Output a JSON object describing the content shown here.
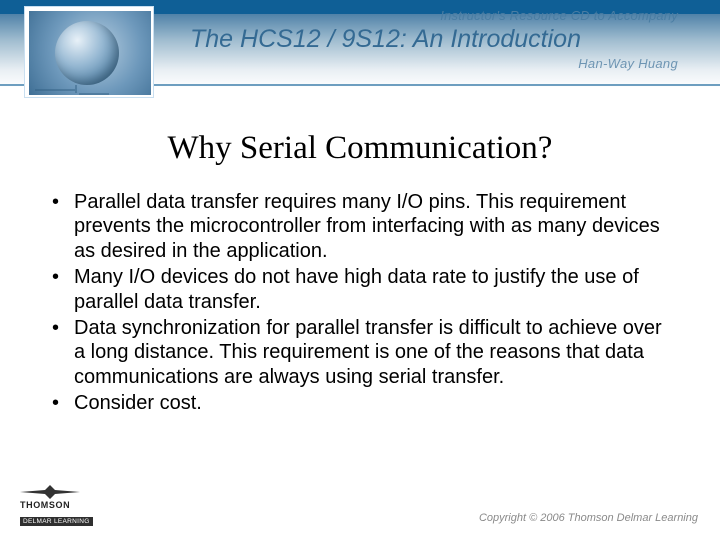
{
  "header": {
    "tagline": "Instructor's Resource CD to Accompany",
    "book_title_prefix": "The ",
    "book_title_main": "HCS12 / 9S12: An Introduction",
    "author": "Han-Way Huang"
  },
  "slide": {
    "title": "Why Serial Communication?",
    "bullets": [
      "Parallel data transfer requires many I/O pins. This requirement prevents the microcontroller from interfacing with as many devices as desired in the application.",
      "Many I/O devices do not have high data rate to justify the use of parallel data transfer.",
      " Data synchronization for parallel transfer is difficult to achieve over a long distance. This requirement is one of the reasons that data communications are always using serial transfer.",
      " Consider cost."
    ]
  },
  "footer": {
    "publisher_brand": "THOMSON",
    "publisher_imprint": "DELMAR LEARNING",
    "copyright": "Copyright © 2006 Thomson Delmar Learning"
  }
}
